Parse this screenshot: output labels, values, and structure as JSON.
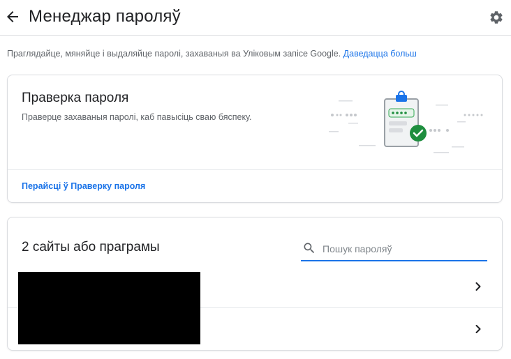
{
  "header": {
    "title": "Менеджар пароляў",
    "back_icon": "arrow-left-icon",
    "settings_icon": "gear-icon"
  },
  "intro": {
    "text": "Праглядайце, мяняйце і выдаляйце паролі, захаваныя ва Уліковым запісе Google.",
    "link": "Даведацца больш"
  },
  "password_check": {
    "title": "Праверка пароля",
    "subtitle": "Праверце захаваныя паролі, каб павысіць сваю бяспеку.",
    "link": "Перайсці ў Праверку пароля"
  },
  "passwords": {
    "title": "2 сайты або праграмы",
    "search_placeholder": "Пошук пароляў",
    "search_value": "",
    "rows": [
      {
        "chevron": "chevron-right-icon"
      },
      {
        "chevron": "chevron-right-icon"
      }
    ]
  },
  "colors": {
    "accent": "#1a73e8",
    "check_green": "#1e8e3e",
    "text_primary": "#202124",
    "text_secondary": "#5f6368",
    "divider": "#dadce0"
  }
}
